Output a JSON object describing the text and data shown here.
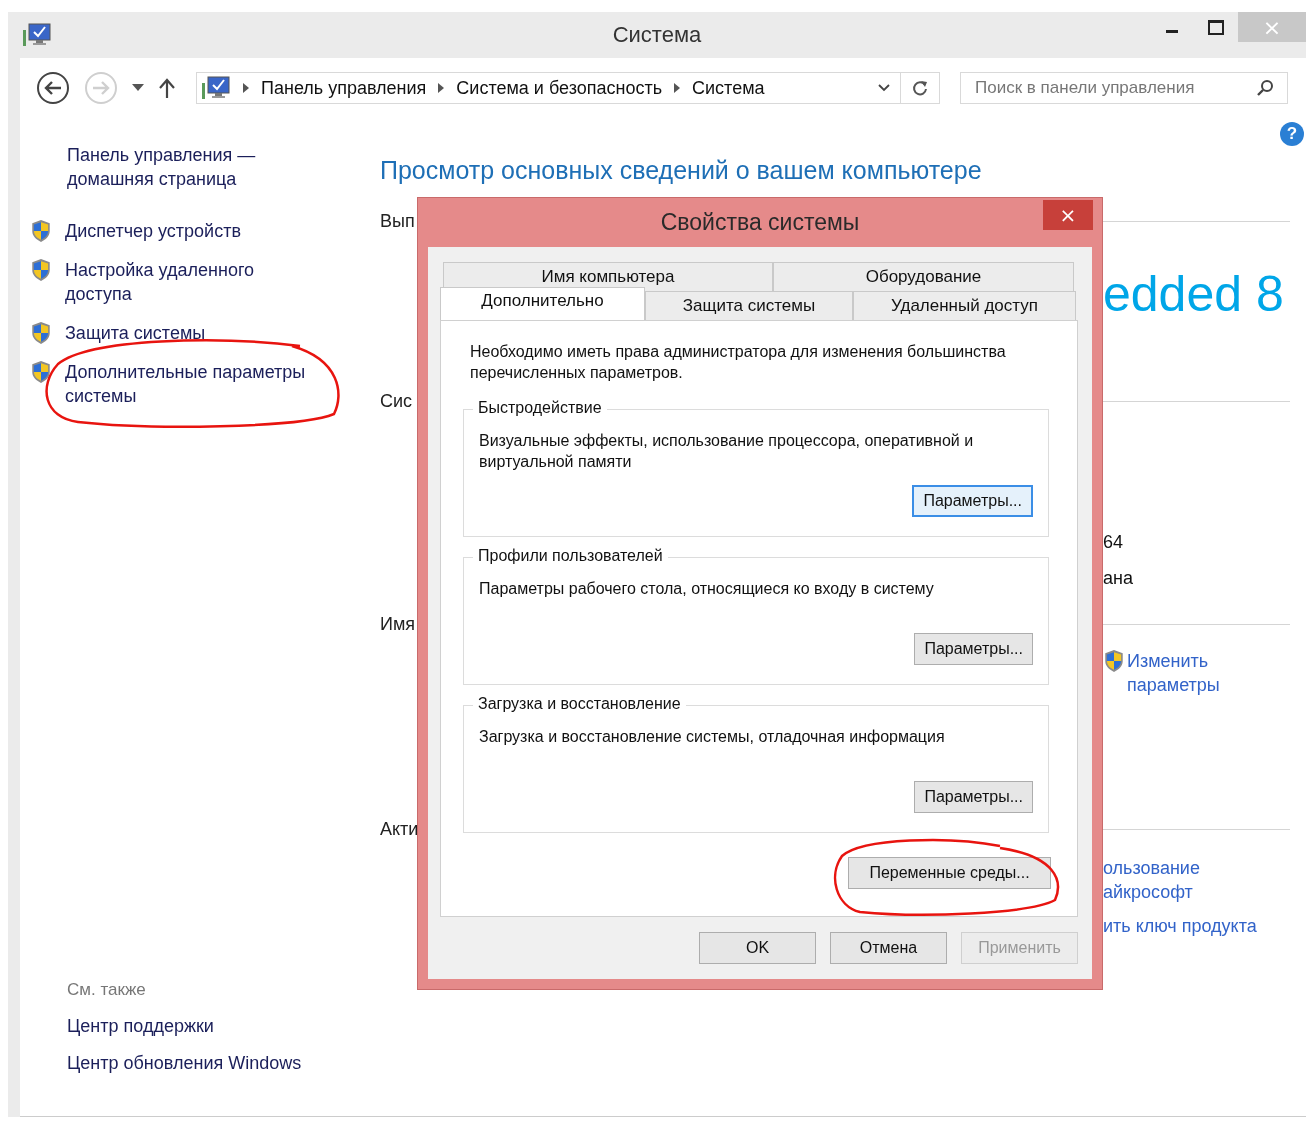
{
  "window": {
    "title": "Система",
    "close_glyph": "×"
  },
  "address_bar": {
    "crumbs": [
      "Панель управления",
      "Система и безопасность",
      "Система"
    ]
  },
  "search": {
    "placeholder": "Поиск в панели управления"
  },
  "help_glyph": "?",
  "sidebar": {
    "home_link": "Панель управления — домашняя страница",
    "items": [
      {
        "label": "Диспетчер устройств"
      },
      {
        "label": "Настройка удаленного доступа"
      },
      {
        "label": "Защита системы"
      },
      {
        "label": "Дополнительные параметры системы"
      }
    ],
    "see_also": {
      "heading": "См. также",
      "links": [
        "Центр поддержки",
        "Центр обновления Windows"
      ]
    }
  },
  "main": {
    "heading": "Просмотр основных сведений о вашем компьютере",
    "sections": [
      {
        "heading": "Вып",
        "items": [
          {
            "kind": "edition",
            "text": "edded 8"
          }
        ]
      },
      {
        "heading": "Сис",
        "items": [
          {
            "kind": "value",
            "text": "64"
          },
          {
            "kind": "value",
            "text": "ана"
          }
        ]
      },
      {
        "heading": "Имя",
        "items": [
          {
            "kind": "shield_link",
            "text": "Изменить параметры"
          }
        ]
      },
      {
        "heading": "Акти",
        "items": [
          {
            "kind": "link",
            "text": "ользование айкрософт"
          },
          {
            "kind": "link",
            "text": "ить ключ продукта"
          }
        ]
      }
    ]
  },
  "dialog": {
    "title": "Свойства системы",
    "close_glyph": "×",
    "tab_rows": [
      [
        {
          "label": "Имя компьютера",
          "selected": false
        },
        {
          "label": "Оборудование",
          "selected": false
        }
      ],
      [
        {
          "label": "Дополнительно",
          "selected": true
        },
        {
          "label": "Защита системы",
          "selected": false
        },
        {
          "label": "Удаленный доступ",
          "selected": false
        }
      ]
    ],
    "notice": "Необходимо иметь права администратора для изменения большинства перечисленных параметров.",
    "groups": [
      {
        "title": "Быстродействие",
        "description": "Визуальные эффекты, использование процессора, оперативной и виртуальной памяти",
        "button": "Параметры...",
        "focused": true
      },
      {
        "title": "Профили пользователей",
        "description": "Параметры рабочего стола, относящиеся ко входу в систему",
        "button": "Параметры...",
        "focused": false
      },
      {
        "title": "Загрузка и восстановление",
        "description": "Загрузка и восстановление системы, отладочная информация",
        "button": "Параметры...",
        "focused": false
      }
    ],
    "env_button": "Переменные среды...",
    "buttons": [
      {
        "label": "OK",
        "disabled": false
      },
      {
        "label": "Отмена",
        "disabled": false
      },
      {
        "label": "Применить",
        "disabled": true
      }
    ]
  }
}
